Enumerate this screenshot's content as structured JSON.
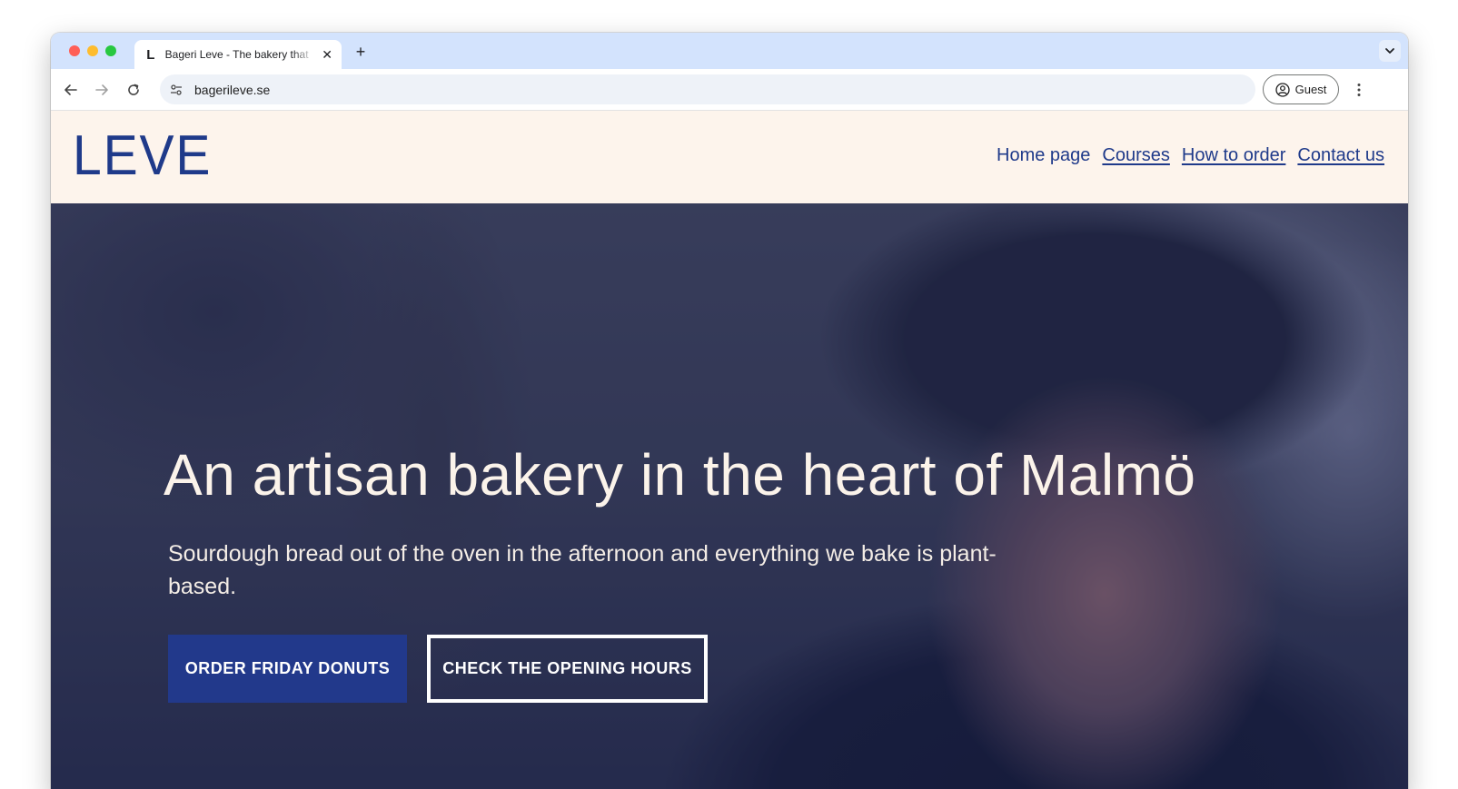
{
  "browser": {
    "tab": {
      "favicon_text": "L",
      "title": "Bageri Leve - The bakery that"
    },
    "toolbar": {
      "url": "bagerileve.se",
      "profile_label": "Guest"
    },
    "icons": {
      "back": "arrow-left-icon",
      "forward": "arrow-right-icon",
      "reload": "reload-icon",
      "site_info": "tune-icon",
      "profile": "account-circle-icon",
      "menu": "more-vert-icon",
      "new_tab": "plus-icon",
      "tab_close": "close-icon",
      "tab_search": "chevron-down-icon"
    }
  },
  "site": {
    "logo": "LEVE",
    "nav": [
      {
        "label": "Home page"
      },
      {
        "label": "Courses"
      },
      {
        "label": "How to order"
      },
      {
        "label": "Contact us"
      }
    ],
    "hero": {
      "title": "An artisan bakery in the heart of Malmö",
      "subtitle": "Sourdough bread out of the oven in the afternoon and everything we bake is plant-based.",
      "primary_cta": "ORDER FRIDAY DONUTS",
      "secondary_cta": "CHECK THE OPENING HOURS"
    },
    "colors": {
      "brand_blue": "#1f3a8a",
      "header_bg": "#fdf4ec",
      "button_blue": "#22398b"
    }
  }
}
